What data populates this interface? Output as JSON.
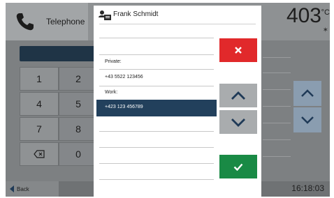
{
  "topbar": {
    "phone_label": "Telephone",
    "temperature": "403",
    "temperature_unit": "°C",
    "status_icon": "bluetooth-icon"
  },
  "dialpad": {
    "keys": [
      "1",
      "2",
      "4",
      "5",
      "7",
      "8",
      "0"
    ],
    "backspace_icon": "backspace-icon"
  },
  "dialog": {
    "contact_name": "Frank Schmidt",
    "contact_icon": "contact-card-icon",
    "private_label": "Private:",
    "private_number": "+43 5522 123456",
    "work_label": "Work:",
    "work_number": "+423 123 456789",
    "cancel_icon": "close-icon",
    "up_icon": "chevron-up-icon",
    "down_icon": "chevron-down-icon",
    "confirm_icon": "check-icon"
  },
  "bottombar": {
    "back_label": "Back",
    "clock": "16:18:03"
  },
  "colors": {
    "accent_navy": "#22405c",
    "cancel_red": "#e1292b",
    "confirm_green": "#198a45"
  }
}
